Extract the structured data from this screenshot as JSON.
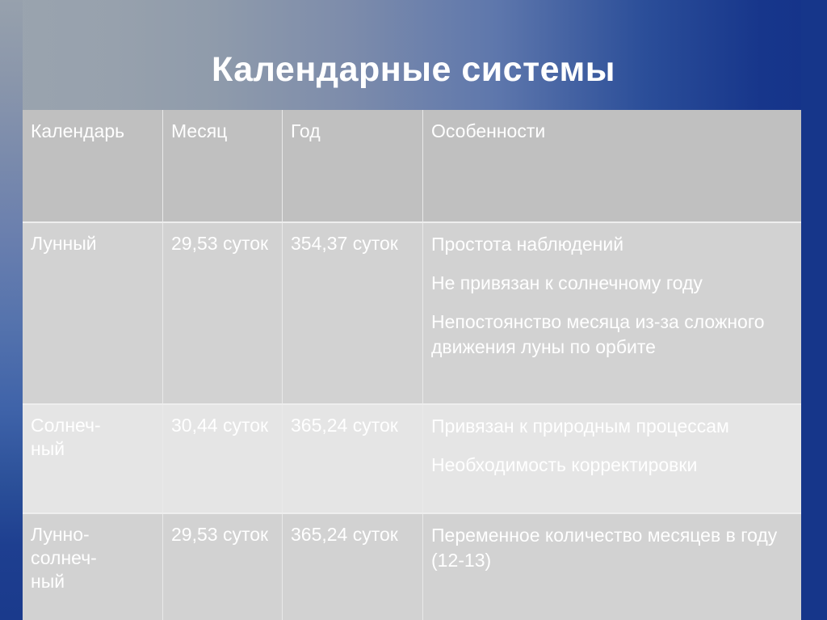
{
  "slide": {
    "title": "Календарные системы",
    "background": {
      "accent_blue": "#16368a",
      "gradient_gray": "#9aa4af",
      "title_color": "#ffffff"
    }
  },
  "table": {
    "header_bg": "#c0c0c0",
    "row_bg_odd": "#d2d2d2",
    "row_bg_even": "#e5e5e5",
    "text_color": "#ffffff",
    "columns": [
      {
        "key": "calendar",
        "label": "Календарь"
      },
      {
        "key": "month",
        "label": "Месяц"
      },
      {
        "key": "year",
        "label": "Год"
      },
      {
        "key": "features",
        "label": "Особенности"
      }
    ],
    "rows": [
      {
        "calendar": "Лунный",
        "month": "29,53 суток",
        "year": "354,37 суток",
        "features": [
          "Простота наблюдений",
          "Не привязан к солнечному году",
          "Непостоянство месяца из-за сложного движения луны по орбите"
        ]
      },
      {
        "calendar": "Солнеч-ный",
        "month": "30,44 суток",
        "year": "365,24 суток",
        "features": [
          "Привязан к природным процессам",
          "Необходимость корректировки"
        ]
      },
      {
        "calendar": "Лунно-солнеч-ный",
        "month": "29,53 суток",
        "year": "365,24 суток",
        "features": [
          "Переменное количество месяцев в году (12-13)"
        ]
      }
    ]
  }
}
